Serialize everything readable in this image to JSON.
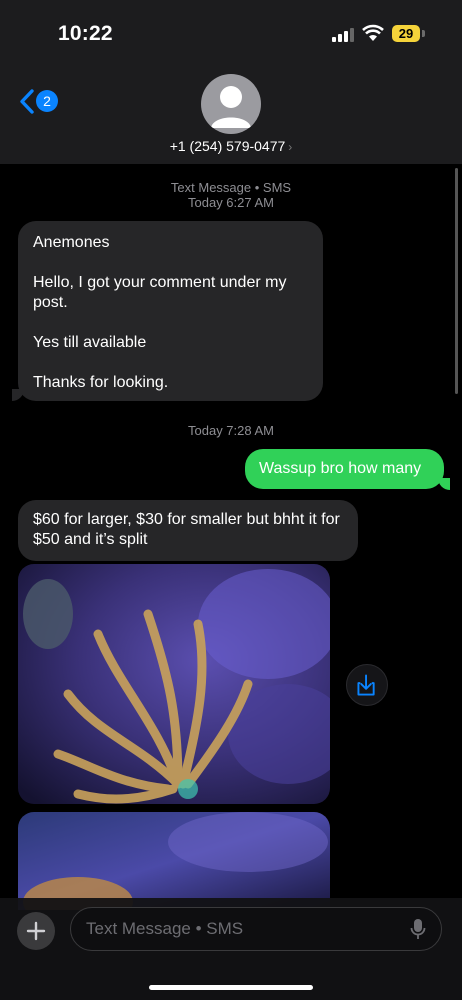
{
  "status_bar": {
    "time": "10:22",
    "battery": "29"
  },
  "header": {
    "back_badge": "2",
    "contact": "+1 (254) 579-0477",
    "chevron": "›"
  },
  "thread": {
    "stamp1_service": "Text Message • SMS",
    "stamp1_time": "Today 6:27 AM",
    "msg1_lines": [
      "Anemones",
      "Hello, I got your comment under my post.",
      "Yes till available",
      "Thanks for looking."
    ],
    "stamp2_time": "Today 7:28 AM",
    "msg2": "Wassup bro how many",
    "msg3": "$60 for larger, $30 for smaller but bhht it for $50 and it’s split"
  },
  "input": {
    "placeholder": "Text Message • SMS"
  },
  "icons": [
    "back-chevron-icon",
    "person-icon",
    "download-icon",
    "plus-icon",
    "microphone-icon"
  ],
  "colors": {
    "outgoing_bubble": "#30d158",
    "incoming_bubble": "#262628",
    "accent": "#0a84ff",
    "battery": "#f5d33a"
  }
}
